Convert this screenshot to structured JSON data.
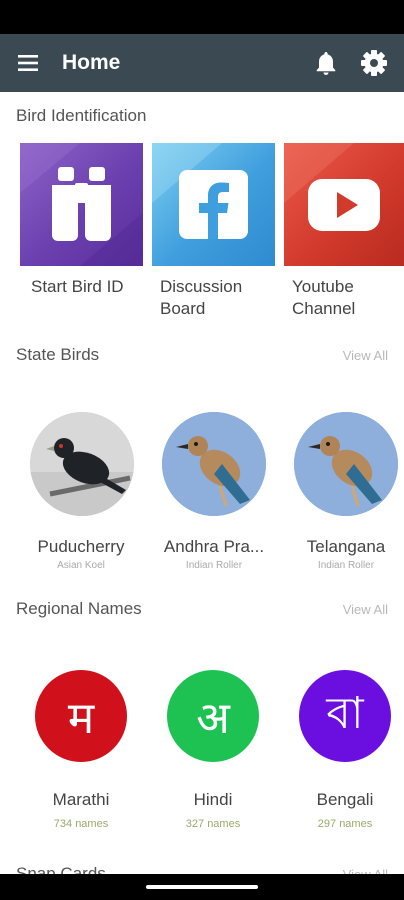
{
  "app_bar": {
    "title": "Home",
    "menu_icon": "hamburger-menu-icon",
    "notification_icon": "bell-icon",
    "settings_icon": "gear-icon"
  },
  "bird_identification": {
    "title": "Bird Identification",
    "tiles": [
      {
        "label": "Start Bird ID",
        "icon": "binoculars-icon",
        "color": "#7b52b8"
      },
      {
        "label": "Discussion Board",
        "icon": "facebook-icon",
        "color": "#4aa6dd"
      },
      {
        "label": "Youtube Channel",
        "icon": "youtube-icon",
        "color": "#d8352c"
      }
    ]
  },
  "state_birds": {
    "title": "State Birds",
    "view_all": "View All",
    "items": [
      {
        "name": "Puducherry",
        "bird": "Asian Koel"
      },
      {
        "name": "Andhra Pra...",
        "bird": "Indian Roller"
      },
      {
        "name": "Telangana",
        "bird": "Indian Roller"
      }
    ]
  },
  "regional_names": {
    "title": "Regional Names",
    "view_all": "View All",
    "items": [
      {
        "glyph": "म",
        "name": "Marathi",
        "count": "734 names",
        "color": "#d0111b"
      },
      {
        "glyph": "अ",
        "name": "Hindi",
        "count": "327 names",
        "color": "#1ec253"
      },
      {
        "glyph": "বা",
        "name": "Bengali",
        "count": "297 names",
        "color": "#6a0fe0"
      }
    ]
  },
  "snap_cards": {
    "title": "Snap Cards",
    "view_all": "View All"
  }
}
